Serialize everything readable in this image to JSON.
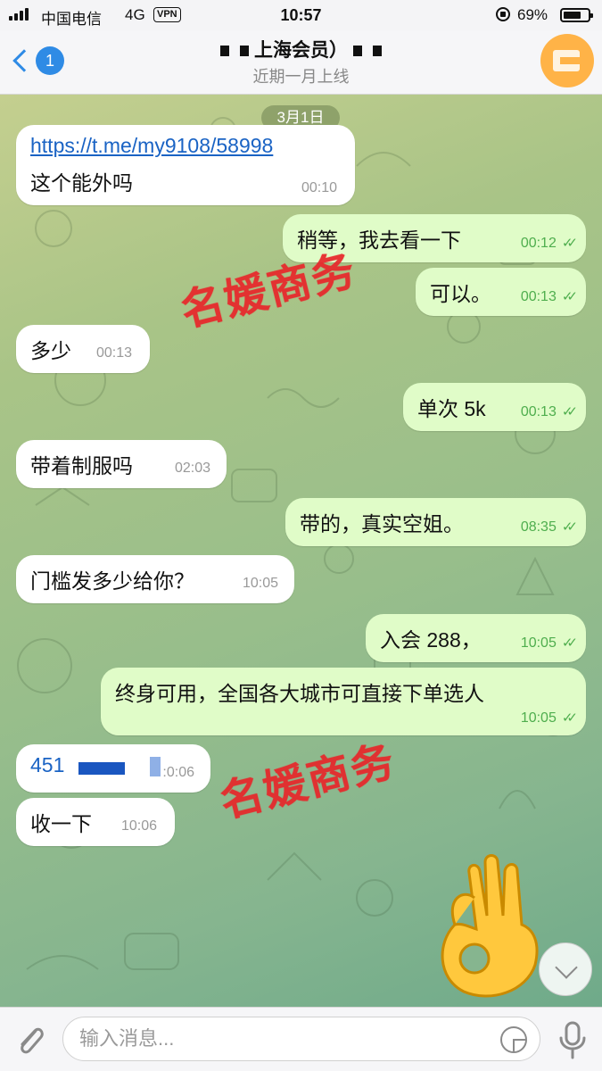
{
  "status_bar": {
    "carrier": "中国电信",
    "network": "4G",
    "vpn": "VPN",
    "time": "10:57",
    "battery": "69%"
  },
  "header": {
    "back_badge": "1",
    "title": "上海会员）",
    "subtitle": "近期一月上线"
  },
  "chat": {
    "date": "3月1日",
    "messages": [
      {
        "dir": "in",
        "link": "https://t.me/my9108/58998",
        "text": "这个能外吗",
        "time": "00:10"
      },
      {
        "dir": "out",
        "text": "稍等，我去看一下",
        "time": "00:12"
      },
      {
        "dir": "out",
        "text": "可以。",
        "time": "00:13"
      },
      {
        "dir": "in",
        "text": "多少",
        "time": "00:13"
      },
      {
        "dir": "out",
        "text": "单次 5k",
        "time": "00:13"
      },
      {
        "dir": "in",
        "text": "带着制服吗",
        "time": "02:03"
      },
      {
        "dir": "out",
        "text": "带的，真实空姐。",
        "time": "08:35"
      },
      {
        "dir": "in",
        "text": "门槛发多少给你？",
        "time": "10:05"
      },
      {
        "dir": "out",
        "text": "入会 288，",
        "time": "10:05"
      },
      {
        "dir": "out",
        "text": "终身可用，全国各大城市可直接下单选人",
        "time": "10:05"
      },
      {
        "dir": "in",
        "text": "451",
        "time": ":0:06"
      },
      {
        "dir": "in",
        "text": "收一下",
        "time": "10:06"
      }
    ],
    "watermark": "名媛商务"
  },
  "input": {
    "placeholder": "输入消息..."
  },
  "colors": {
    "accent": "#2f8be5",
    "outgoing_bubble": "#e0fcc8",
    "incoming_bubble": "#ffffff",
    "watermark": "#e8262a",
    "check": "#4fae4e"
  }
}
